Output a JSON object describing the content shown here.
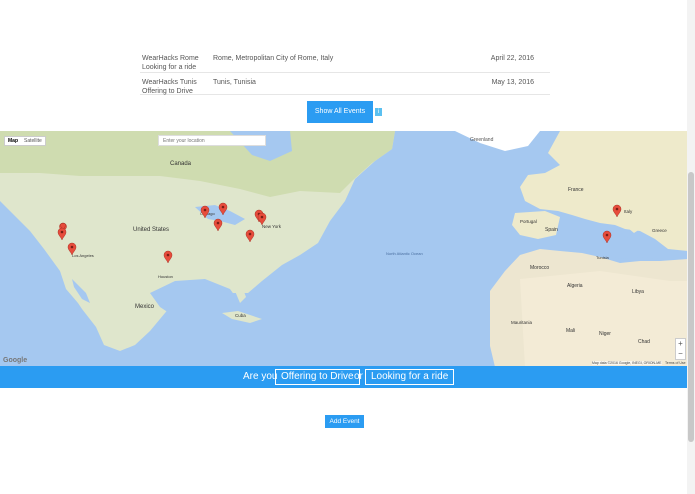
{
  "events": [
    {
      "name": "WearHacks Rome",
      "role": "Looking for a ride",
      "place": "Rome, Metropolitan City of Rome, Italy",
      "date": "April 22, 2016"
    },
    {
      "name": "WearHacks Tunis",
      "role": "Offering to Drive",
      "place": "Tunis, Tunisia",
      "date": "May 13, 2016"
    }
  ],
  "show_all": "Show All Events",
  "info_badge": "i",
  "map": {
    "type_map": "Map",
    "type_satellite": "Satellite",
    "search_placeholder": "Enter your location",
    "zoom_in": "+",
    "zoom_out": "−",
    "provider": "Google",
    "credit": "Map data ©2016 Google, INEGI, ORION-ME",
    "terms": "Terms of Use",
    "labels": {
      "canada_na": "Canada",
      "united_states": "United States",
      "mexico": "Mexico",
      "greenland": "Greenland",
      "north_atlantic": "North Atlantic Ocean",
      "cuba": "Cuba",
      "france": "France",
      "spain": "Spain",
      "portugal": "Portugal",
      "italy": "Italy",
      "morocco": "Morocco",
      "algeria": "Algeria",
      "libya": "Libya",
      "mali": "Mali",
      "niger": "Niger",
      "chad": "Chad",
      "mauritania": "Mauritania",
      "tunisia": "Tunisia",
      "greece": "Greece",
      "new_york": "New York",
      "los_angeles": "Los Angeles",
      "houston": "Houston",
      "chicago": "Chicago"
    }
  },
  "cta": {
    "prefix": "Are you",
    "offering": "Offering to Drive",
    "or": "or",
    "looking": "Looking for a ride"
  },
  "add_event": "Add Event",
  "colors": {
    "accent": "#2b9cf2",
    "marker": "#e74c3c"
  }
}
